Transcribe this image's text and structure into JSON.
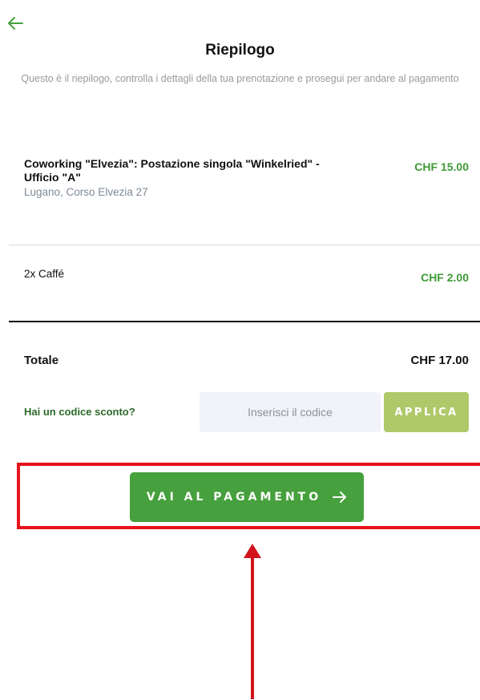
{
  "header": {
    "back_icon": "arrow-left-icon",
    "title": "Riepilogo",
    "subtitle": "Questo è il riepilogo, controlla i dettagli della tua prenotazione e prosegui per andare al pagamento"
  },
  "items": [
    {
      "name": "Coworking \"Elvezia\": Postazione singola \"Winkelried\" - Ufficio \"A\"",
      "location": "Lugano, Corso Elvezia 27",
      "price": "CHF 15.00"
    },
    {
      "name": "2x Caffé",
      "price": "CHF 2.00"
    }
  ],
  "total": {
    "label": "Totale",
    "value": "CHF 17.00"
  },
  "discount": {
    "label": "Hai un codice sconto?",
    "placeholder": "Inserisci il codice",
    "value": "",
    "apply_label": "APPLICA"
  },
  "payment": {
    "label": "VAI AL PAGAMENTO",
    "icon": "arrow-right-icon"
  },
  "colors": {
    "accent_green": "#46a03d",
    "price_green": "#3f9a36",
    "apply_green": "#aec969",
    "annotation_red": "#e8131b"
  }
}
